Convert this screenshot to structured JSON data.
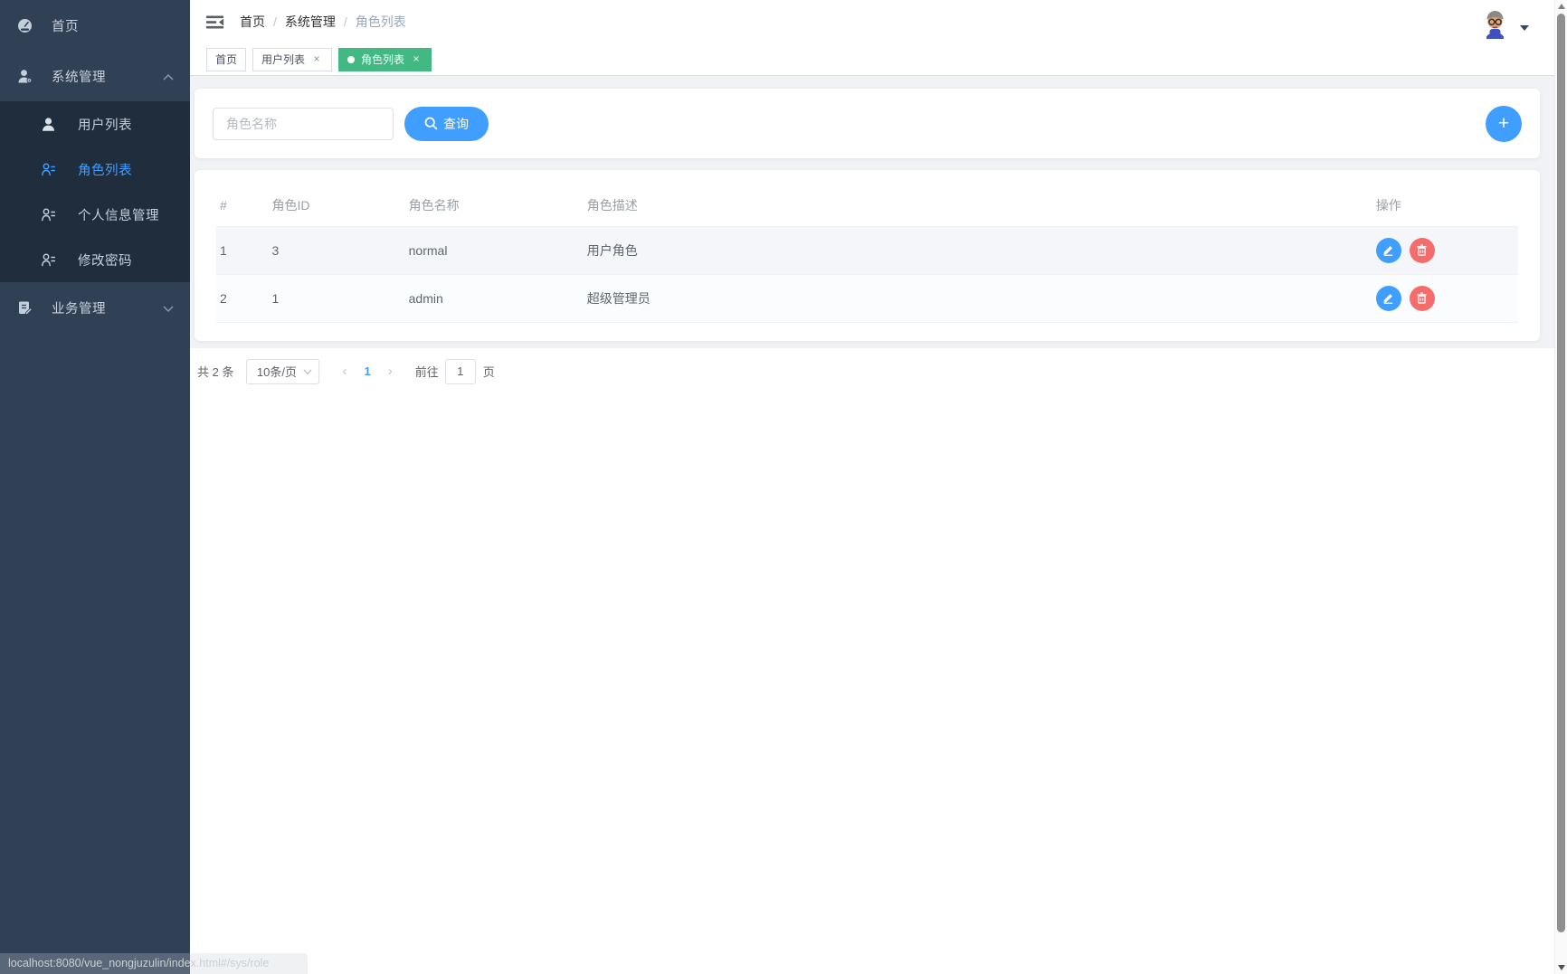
{
  "colors": {
    "accent": "#409eff",
    "success": "#42b983",
    "danger": "#f56c6c",
    "sidebar_bg": "#304156",
    "submenu_bg": "#1f2d3d",
    "workspace_bg": "#f0f2f5"
  },
  "sidebar": {
    "home": "首页",
    "system_mgmt": "系统管理",
    "user_list": "用户列表",
    "role_list": "角色列表",
    "profile_mgmt": "个人信息管理",
    "change_password": "修改密码",
    "business_mgmt": "业务管理"
  },
  "breadcrumb": {
    "sep": "/",
    "items": [
      "首页",
      "系统管理",
      "角色列表"
    ]
  },
  "tabs": {
    "home": {
      "label": "首页"
    },
    "user_list": {
      "label": "用户列表",
      "close": "×"
    },
    "role_list": {
      "label": "角色列表",
      "close": "×"
    }
  },
  "toolbar": {
    "search_placeholder": "角色名称",
    "query_label": "查询",
    "add_label": "+"
  },
  "table": {
    "columns": {
      "index": "#",
      "role_id": "角色ID",
      "role_name": "角色名称",
      "role_desc": "角色描述",
      "actions": "操作"
    },
    "rows": [
      {
        "index": "1",
        "role_id": "3",
        "role_name": "normal",
        "role_desc": "用户角色"
      },
      {
        "index": "2",
        "role_id": "1",
        "role_name": "admin",
        "role_desc": "超级管理员"
      }
    ]
  },
  "pagination": {
    "total": "共 2 条",
    "page_size": "10条/页",
    "prev": "‹",
    "page": "1",
    "next": "›",
    "goto_label": "前往",
    "goto_value": "1",
    "unit": "页"
  },
  "statusbar": {
    "url": "localhost:8080/vue_nongjuzulin/index.html#/sys/role"
  }
}
